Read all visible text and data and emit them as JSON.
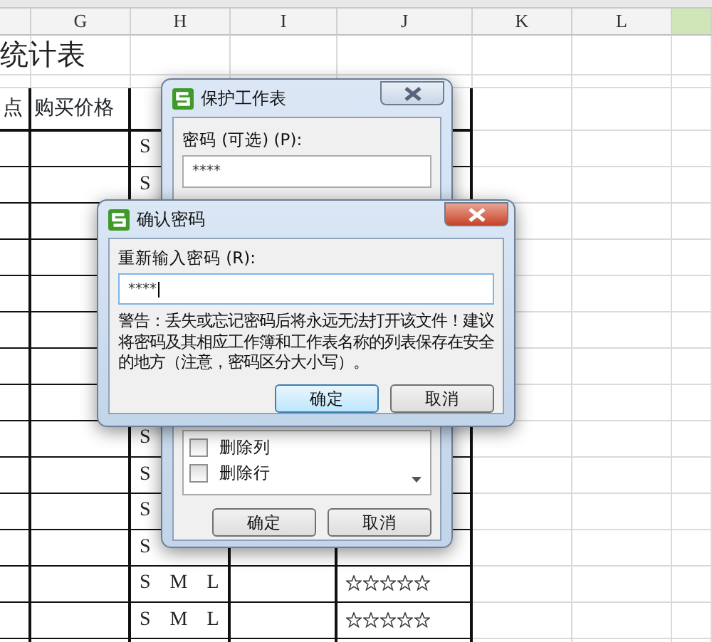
{
  "sheet": {
    "columns": [
      {
        "selected": false
      },
      {
        "label": "G",
        "selected": false
      },
      {
        "label": "H",
        "selected": false
      },
      {
        "label": "I",
        "selected": false
      },
      {
        "label": "J",
        "selected": false
      },
      {
        "label": "K",
        "selected": false
      },
      {
        "label": "L",
        "selected": false
      },
      {
        "selected": true
      }
    ],
    "title": "统计表",
    "header_cells": [
      "点",
      "购买价格"
    ],
    "rows": [
      {
        "sizes": "S"
      },
      {
        "sizes": "S"
      },
      {},
      {},
      {},
      {},
      {},
      {},
      {
        "sizes": "S"
      },
      {
        "sizes": "S"
      },
      {
        "sizes": "S"
      },
      {
        "sizes": "S"
      },
      {
        "sizes": "S M L",
        "stars": 0
      },
      {
        "sizes": "S M L",
        "stars": 0
      }
    ]
  },
  "protect_dialog": {
    "title": "保护工作表",
    "password_label": "密码 (可选) (P):",
    "password_value": "****",
    "permissions": [
      {
        "label": "删除列",
        "checked": false
      },
      {
        "label": "删除行",
        "checked": false
      }
    ],
    "buttons": [
      "确定",
      "取消"
    ]
  },
  "confirm_dialog": {
    "title": "确认密码",
    "label": "重新输入密码 (R):",
    "value": "****",
    "warning": "警告：丢失或忘记密码后将永远无法打开该文件！建议将密码及其相应工作簿和工作表名称的列表保存在安全的地方（注意，密码区分大小写）。",
    "buttons": [
      {
        "label": "确定",
        "focused": true
      },
      {
        "label": "取消",
        "focused": false
      }
    ]
  }
}
